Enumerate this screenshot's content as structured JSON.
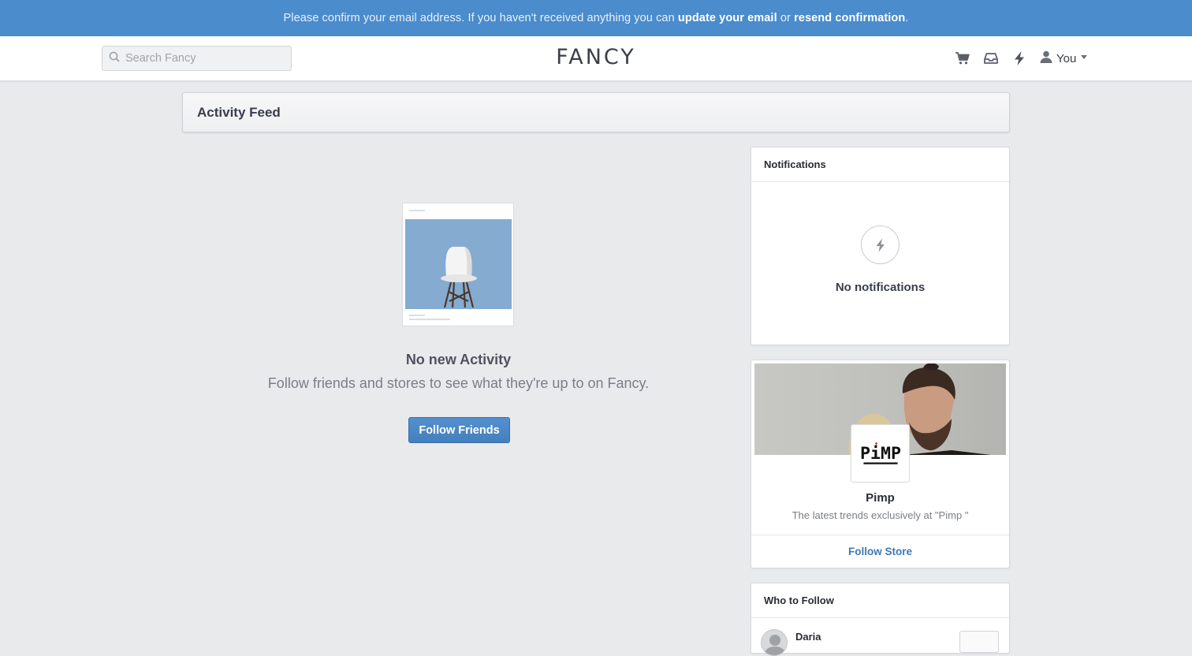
{
  "banner": {
    "text_before": "Please confirm your email address. If you haven't received anything you can ",
    "link_update": "update your email",
    "text_or": " or ",
    "link_resend": "resend confirmation",
    "text_after": "."
  },
  "header": {
    "search_placeholder": "Search Fancy",
    "logo": "FANCY",
    "icons": [
      "cart-icon",
      "inbox-icon",
      "bolt-icon",
      "user-icon"
    ],
    "user_label": "You"
  },
  "feed": {
    "title": "Activity Feed",
    "empty_title": "No new Activity",
    "empty_subtitle": "Follow friends and stores to see what they're up to on Fancy.",
    "follow_button": "Follow Friends"
  },
  "notifications": {
    "title": "Notifications",
    "empty_text": "No notifications"
  },
  "store": {
    "logo_text": "PiMP",
    "name": "Pimp",
    "description": "The latest trends exclusively at \"Pimp \"",
    "follow_label": "Follow Store"
  },
  "who_to_follow": {
    "title": "Who to Follow",
    "people": [
      {
        "name": "Daria"
      }
    ]
  },
  "colors": {
    "banner_bg": "#4a8ccc",
    "page_bg": "#e9eaec",
    "primary_button": "#4a87c6",
    "link": "#3d78b6"
  }
}
